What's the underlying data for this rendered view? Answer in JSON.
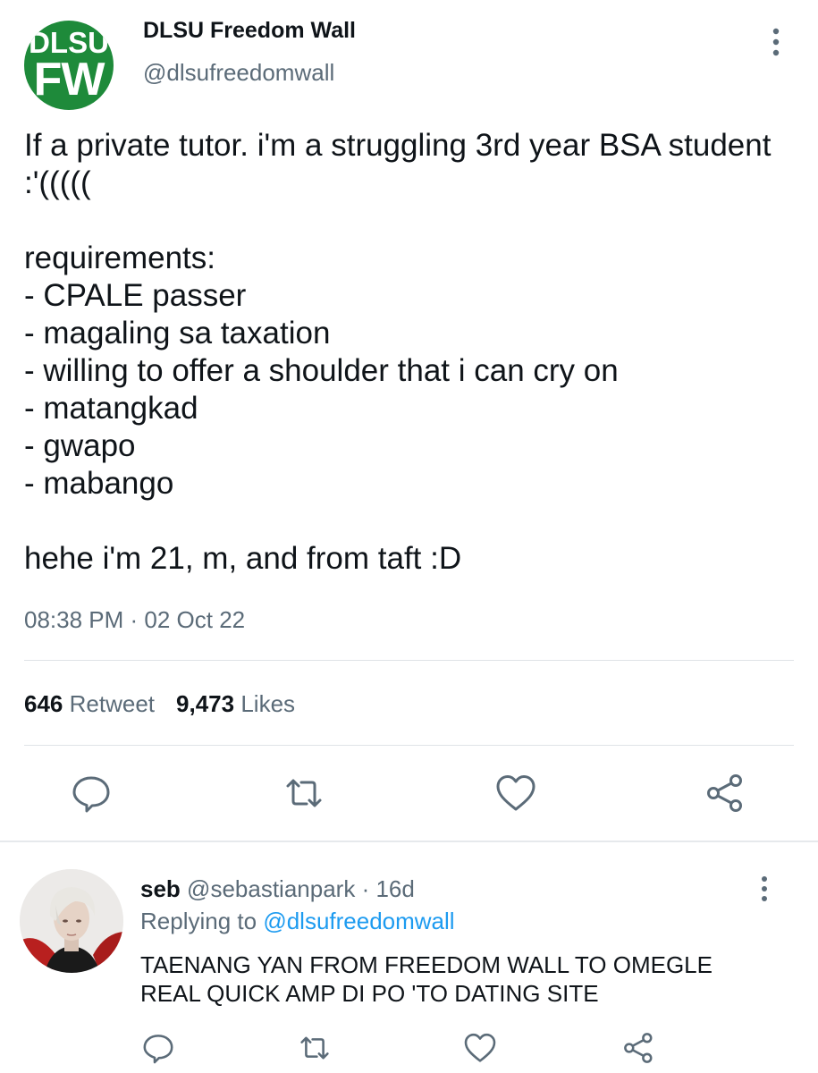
{
  "account": {
    "avatar_line1": "DLSU",
    "avatar_line2": "FW",
    "display_name": "DLSU Freedom Wall",
    "handle": "@dlsufreedomwall"
  },
  "tweet": {
    "text": "If a private tutor. i'm a struggling 3rd year BSA student :'(((((\n\nrequirements:\n- CPALE passer\n- magaling sa taxation\n- willing to offer a shoulder that i can cry on\n- matangkad\n- gwapo\n- mabango\n\nhehe i'm 21, m, and from taft :D",
    "timestamp": "08:38 PM · 02 Oct 22"
  },
  "stats": {
    "retweet_count": "646",
    "retweet_label": "Retweet",
    "likes_count": "9,473",
    "likes_label": "Likes"
  },
  "actions": [
    "reply-icon",
    "retweet-icon",
    "like-icon",
    "share-icon"
  ],
  "reply": {
    "name": "seb",
    "handle": "@sebastianpark",
    "age": "· 16d",
    "replying_to_label": "Replying to",
    "replying_to_handle": "@dlsufreedomwall",
    "text": "TAENANG YAN FROM FREEDOM WALL TO OMEGLE\nREAL QUICK AMP DI PO 'TO DATING SITE"
  },
  "colors": {
    "brand_green": "#1e8a3a",
    "mention_blue": "#1d9bf0",
    "muted_gray": "#5b6b78"
  }
}
